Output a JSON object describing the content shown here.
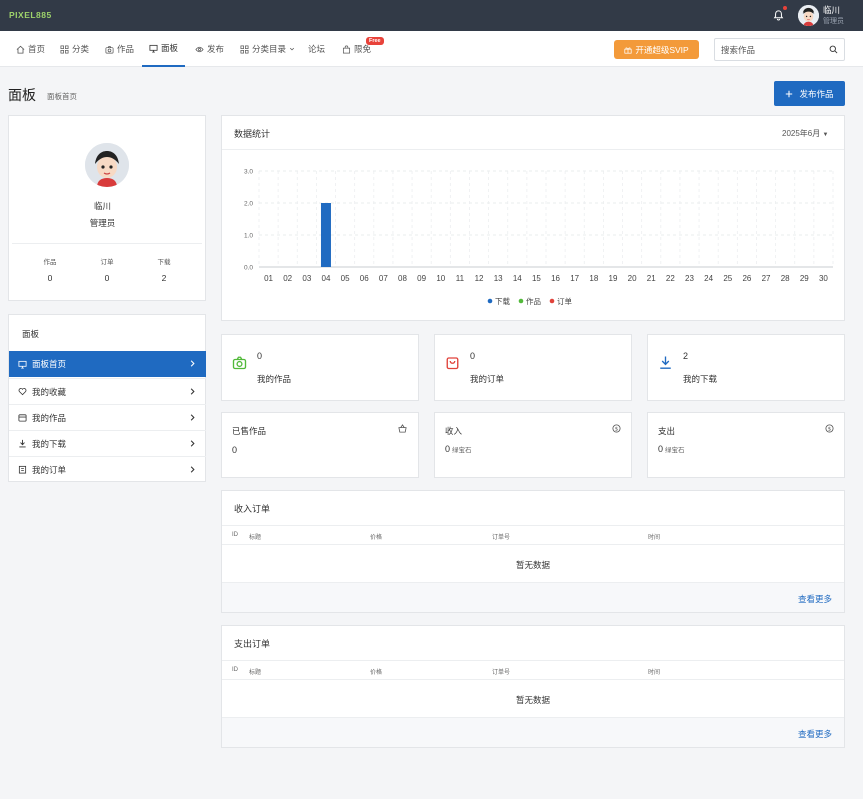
{
  "topbar": {
    "logo": "PIXEL885",
    "user_name": "临川",
    "user_role": "管理员"
  },
  "nav": {
    "items": [
      {
        "label": "首页",
        "icon": "home-icon"
      },
      {
        "label": "分类",
        "icon": "grid-icon"
      },
      {
        "label": "作品",
        "icon": "camera-icon"
      },
      {
        "label": "面板",
        "icon": "monitor-icon"
      },
      {
        "label": "发布",
        "icon": "eye-icon"
      },
      {
        "label": "分类目录",
        "icon": "grid-icon"
      },
      {
        "label": "论坛",
        "icon": ""
      },
      {
        "label": "限免",
        "icon": "bag-icon"
      }
    ],
    "active": "面板",
    "free_badge": "Free",
    "svip_label": "开通超级SVIP",
    "search_placeholder": "搜索作品"
  },
  "page": {
    "title": "面板",
    "breadcrumb": "面板首页",
    "publish_label": "发布作品"
  },
  "profile": {
    "name": "临川",
    "role": "管理员",
    "stats": [
      {
        "label": "作品",
        "value": "0"
      },
      {
        "label": "订单",
        "value": "0"
      },
      {
        "label": "下载",
        "value": "2"
      }
    ]
  },
  "menu": {
    "title": "面板",
    "items": [
      {
        "label": "面板首页",
        "icon": "monitor-icon",
        "active": true
      },
      {
        "label": "我的收藏",
        "icon": "heart-icon"
      },
      {
        "label": "我的作品",
        "icon": "box-icon"
      },
      {
        "label": "我的下载",
        "icon": "download-icon"
      },
      {
        "label": "我的订单",
        "icon": "clipboard-icon"
      }
    ]
  },
  "chart_panel": {
    "title": "数据统计",
    "month": "2025年6月"
  },
  "chart_data": {
    "type": "bar",
    "categories": [
      "01",
      "02",
      "03",
      "04",
      "05",
      "06",
      "07",
      "08",
      "09",
      "10",
      "11",
      "12",
      "13",
      "14",
      "15",
      "16",
      "17",
      "18",
      "19",
      "20",
      "21",
      "22",
      "23",
      "24",
      "25",
      "26",
      "27",
      "28",
      "29",
      "30"
    ],
    "series": [
      {
        "name": "下载",
        "color": "#1f6ac1",
        "values": [
          0,
          0,
          0,
          2,
          0,
          0,
          0,
          0,
          0,
          0,
          0,
          0,
          0,
          0,
          0,
          0,
          0,
          0,
          0,
          0,
          0,
          0,
          0,
          0,
          0,
          0,
          0,
          0,
          0,
          0
        ]
      },
      {
        "name": "作品",
        "color": "#52b93a",
        "values": [
          0,
          0,
          0,
          0,
          0,
          0,
          0,
          0,
          0,
          0,
          0,
          0,
          0,
          0,
          0,
          0,
          0,
          0,
          0,
          0,
          0,
          0,
          0,
          0,
          0,
          0,
          0,
          0,
          0,
          0
        ]
      },
      {
        "name": "订单",
        "color": "#e0423a",
        "values": [
          0,
          0,
          0,
          0,
          0,
          0,
          0,
          0,
          0,
          0,
          0,
          0,
          0,
          0,
          0,
          0,
          0,
          0,
          0,
          0,
          0,
          0,
          0,
          0,
          0,
          0,
          0,
          0,
          0,
          0
        ]
      }
    ],
    "y_ticks": [
      "0.0",
      "1.0",
      "2.0",
      "3.0"
    ],
    "ylim": [
      0,
      3
    ],
    "grid": true,
    "legend": "bottom"
  },
  "summary_cards": [
    {
      "value": "0",
      "label": "我的作品",
      "icon": "camera-icon",
      "color": "#52b93a"
    },
    {
      "value": "0",
      "label": "我的订单",
      "icon": "bag-icon",
      "color": "#e0423a"
    },
    {
      "value": "2",
      "label": "我的下载",
      "icon": "download-icon",
      "color": "#1f6ac1"
    }
  ],
  "money_cards": [
    {
      "label": "已售作品",
      "value": "0",
      "unit": "",
      "icon": "basket-icon"
    },
    {
      "label": "收入",
      "value": "0",
      "unit": "绿宝石",
      "icon": "coin-icon"
    },
    {
      "label": "支出",
      "value": "0",
      "unit": "绿宝石",
      "icon": "coin-icon"
    }
  ],
  "income_table": {
    "title": "收入订单",
    "columns": [
      "ID",
      "标题",
      "价格",
      "订单号",
      "时间"
    ],
    "empty": "暂无数据",
    "more": "查看更多"
  },
  "expense_table": {
    "title": "支出订单",
    "columns": [
      "ID",
      "标题",
      "价格",
      "订单号",
      "时间"
    ],
    "empty": "暂无数据",
    "more": "查看更多"
  }
}
